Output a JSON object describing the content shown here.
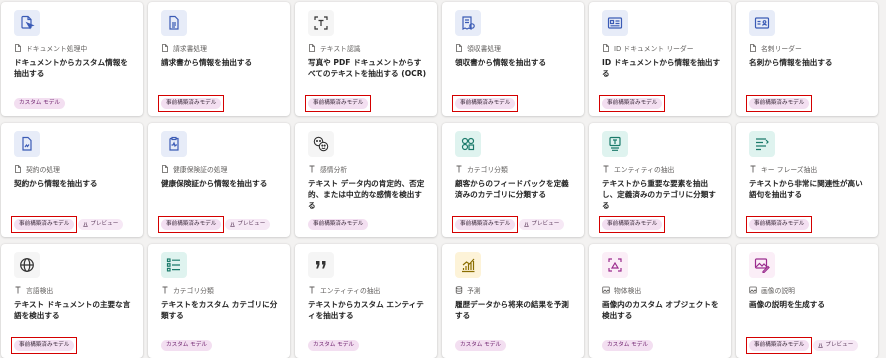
{
  "colors": {
    "accent": "#d40000",
    "tag_bg": "#f3dff1"
  },
  "cards": [
    {
      "icon": "document-cursor-icon",
      "tile": "#e7ecf8",
      "cat_icon": "doc",
      "category": "ドキュメント処理中",
      "title": "ドキュメントからカスタム情報を抽出する",
      "tags": [
        {
          "text": "カスタム モデル",
          "kind": "custom"
        }
      ]
    },
    {
      "icon": "invoice-icon",
      "tile": "#e7ecf8",
      "cat_icon": "doc",
      "category": "請求書処理",
      "title": "請求書から情報を抽出する",
      "tags": [
        {
          "text": "事前構築済みモデル",
          "kind": "prebuilt",
          "highlight": true
        }
      ]
    },
    {
      "icon": "text-scan-icon",
      "tile": "#ffffff",
      "cat_icon": "doc",
      "category": "テキスト認識",
      "title": "写真や PDF ドキュメントからすべてのテキストを抽出する (OCR)",
      "tags": [
        {
          "text": "事前構築済みモデル",
          "kind": "prebuilt",
          "highlight": true
        }
      ]
    },
    {
      "icon": "receipt-icon",
      "tile": "#e7ecf8",
      "cat_icon": "doc",
      "category": "領収書処理",
      "title": "領収書から情報を抽出する",
      "tags": [
        {
          "text": "事前構築済みモデル",
          "kind": "prebuilt",
          "highlight": true
        }
      ]
    },
    {
      "icon": "id-card-icon",
      "tile": "#e7ecf8",
      "cat_icon": "doc",
      "category": "ID ドキュメント リーダー",
      "title": "ID ドキュメントから情報を抽出する",
      "tags": [
        {
          "text": "事前構築済みモデル",
          "kind": "prebuilt",
          "highlight": true
        }
      ]
    },
    {
      "icon": "business-card-icon",
      "tile": "#e7ecf8",
      "cat_icon": "doc",
      "category": "名刺リーダー",
      "title": "名刺から情報を抽出する",
      "tags": [
        {
          "text": "事前構築済みモデル",
          "kind": "prebuilt",
          "highlight": true
        }
      ]
    },
    {
      "icon": "contract-icon",
      "tile": "#e7ecf8",
      "cat_icon": "doc",
      "category": "契約の処理",
      "title": "契約から情報を抽出する",
      "tags": [
        {
          "text": "事前構築済みモデル",
          "kind": "prebuilt",
          "highlight": true
        },
        {
          "text": "プレビュー",
          "kind": "preview"
        }
      ]
    },
    {
      "icon": "health-document-icon",
      "tile": "#e7ecf8",
      "cat_icon": "doc",
      "category": "健康保険証の処理",
      "title": "健康保険証から情報を抽出する",
      "tags": [
        {
          "text": "事前構築済みモデル",
          "kind": "prebuilt",
          "highlight": true
        },
        {
          "text": "プレビュー",
          "kind": "preview"
        }
      ]
    },
    {
      "icon": "sentiment-icon",
      "tile": "#ffffff",
      "cat_icon": "text",
      "category": "感情分析",
      "title": "テキスト データ内の肯定的、否定的、または中立的な感情を検出する",
      "tags": [
        {
          "text": "事前構築済みモデル",
          "kind": "prebuilt"
        }
      ]
    },
    {
      "icon": "category-icon",
      "tile": "#dff3ef",
      "cat_icon": "text",
      "category": "カテゴリ分類",
      "title": "顧客からのフィードバックを定義済みのカテゴリに分類する",
      "tags": [
        {
          "text": "事前構築済みモデル",
          "kind": "prebuilt",
          "highlight": true
        },
        {
          "text": "プレビュー",
          "kind": "preview"
        }
      ]
    },
    {
      "icon": "entity-icon",
      "tile": "#dff3ef",
      "cat_icon": "text",
      "category": "エンティティの抽出",
      "title": "テキストから重要な要素を抽出し、定義済みのカテゴリに分類する",
      "tags": [
        {
          "text": "事前構築済みモデル",
          "kind": "prebuilt",
          "highlight": true
        }
      ]
    },
    {
      "icon": "key-phrase-icon",
      "tile": "#dff3ef",
      "cat_icon": "text",
      "category": "キー フレーズ抽出",
      "title": "テキストから非常に関連性が高い語句を抽出する",
      "tags": [
        {
          "text": "事前構築済みモデル",
          "kind": "prebuilt",
          "highlight": true
        }
      ]
    },
    {
      "icon": "globe-icon",
      "tile": "#ffffff",
      "cat_icon": "text",
      "category": "言語検出",
      "title": "テキスト ドキュメントの主要な言語を検出する",
      "tags": [
        {
          "text": "事前構築済みモデル",
          "kind": "prebuilt",
          "highlight": true
        }
      ]
    },
    {
      "icon": "list-icon",
      "tile": "#dff3ef",
      "cat_icon": "text",
      "category": "カテゴリ分類",
      "title": "テキストをカスタム カテゴリに分類する",
      "tags": [
        {
          "text": "カスタム モデル",
          "kind": "custom"
        }
      ]
    },
    {
      "icon": "quote-icon",
      "tile": "#ffffff",
      "cat_icon": "text",
      "category": "エンティティの抽出",
      "title": "テキストからカスタム エンティティを抽出する",
      "tags": [
        {
          "text": "カスタム モデル",
          "kind": "custom"
        }
      ]
    },
    {
      "icon": "trend-chart-icon",
      "tile": "#fdf3d8",
      "cat_icon": "db",
      "category": "予測",
      "title": "履歴データから将来の結果を予測する",
      "tags": [
        {
          "text": "カスタム モデル",
          "kind": "custom"
        }
      ]
    },
    {
      "icon": "object-detect-icon",
      "tile": "#fbeef7",
      "cat_icon": "img",
      "category": "物体検出",
      "title": "画像内のカスタム オブジェクトを検出する",
      "tags": [
        {
          "text": "カスタム モデル",
          "kind": "custom"
        }
      ]
    },
    {
      "icon": "image-edit-icon",
      "tile": "#fbeef7",
      "cat_icon": "img",
      "category": "画像の説明",
      "title": "画像の説明を生成する",
      "tags": [
        {
          "text": "事前構築済みモデル",
          "kind": "prebuilt",
          "highlight": true
        },
        {
          "text": "プレビュー",
          "kind": "preview"
        }
      ]
    }
  ]
}
